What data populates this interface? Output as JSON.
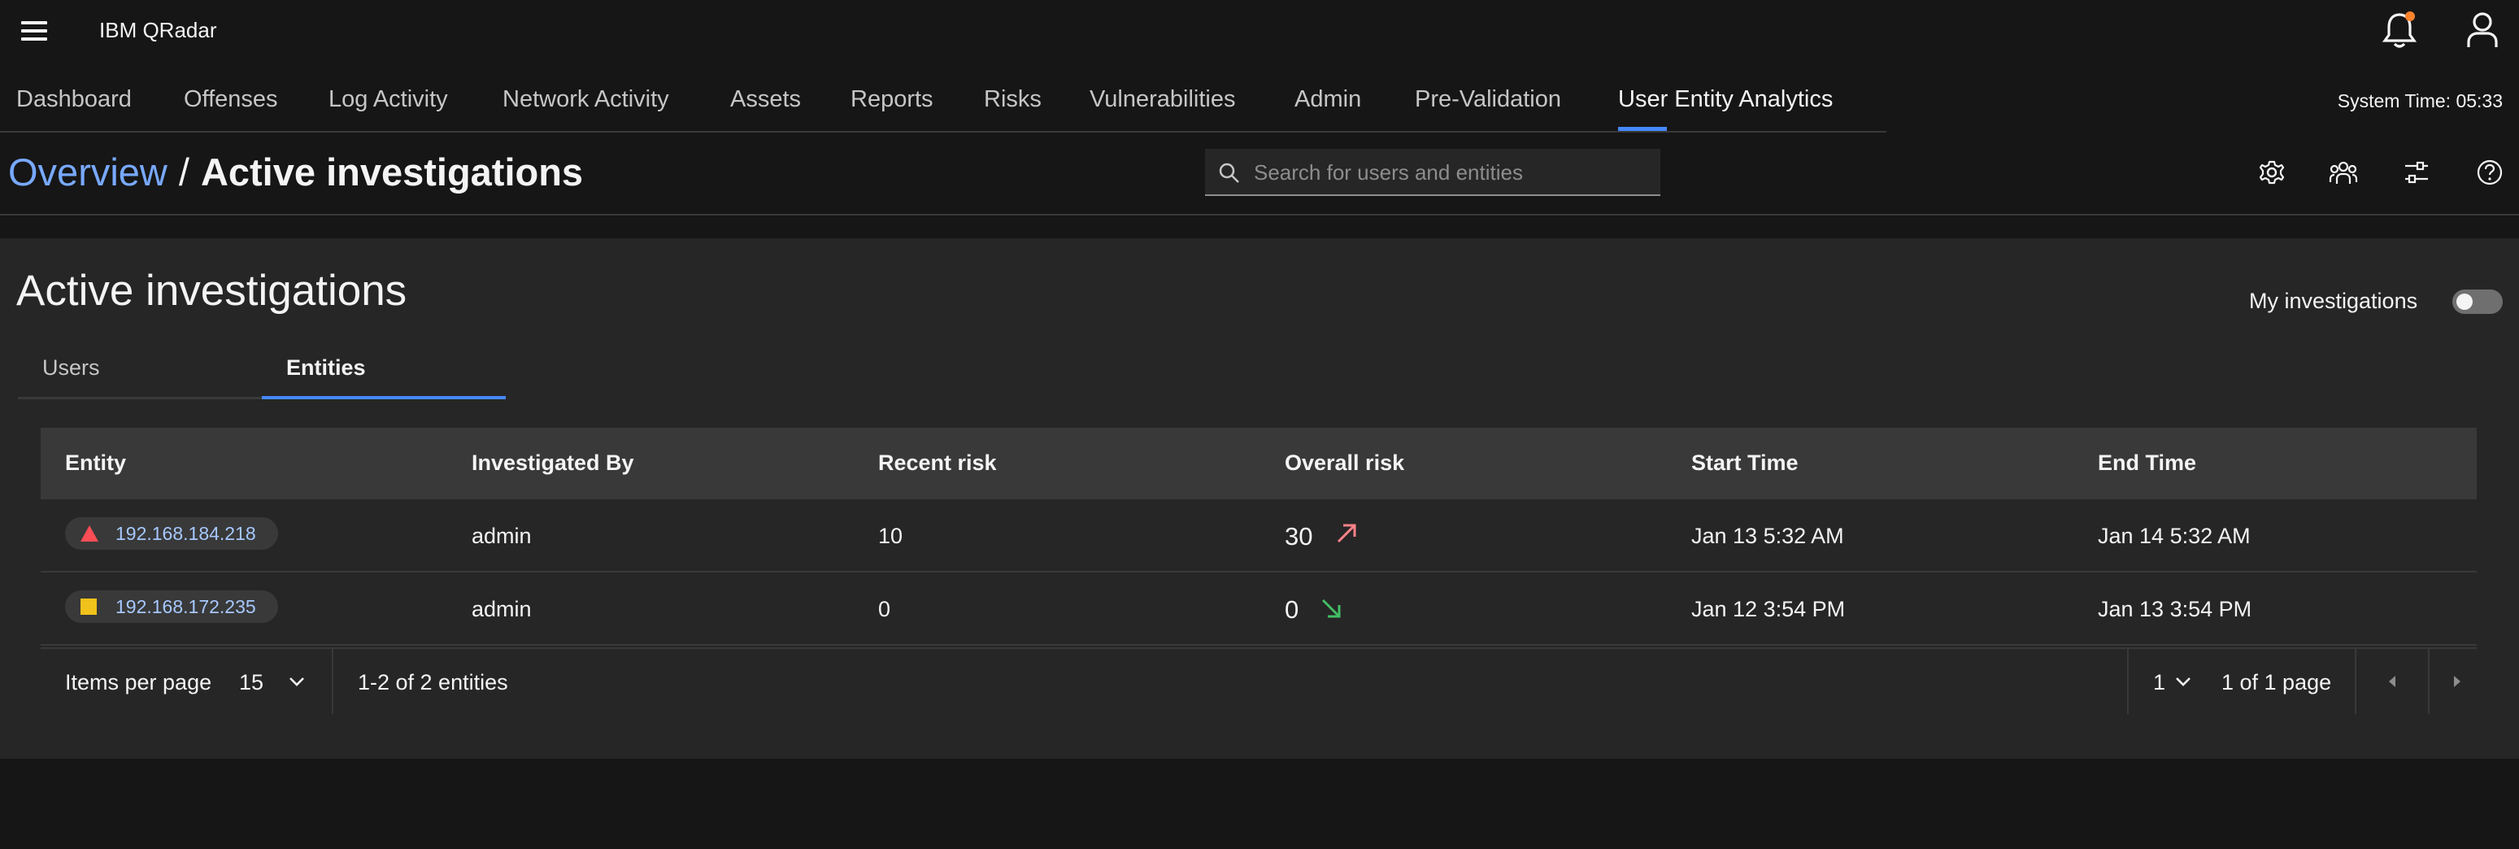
{
  "app": {
    "title": "IBM QRadar"
  },
  "nav": {
    "items": [
      {
        "label": "Dashboard"
      },
      {
        "label": "Offenses"
      },
      {
        "label": "Log Activity"
      },
      {
        "label": "Network Activity"
      },
      {
        "label": "Assets"
      },
      {
        "label": "Reports"
      },
      {
        "label": "Risks"
      },
      {
        "label": "Vulnerabilities"
      },
      {
        "label": "Admin"
      },
      {
        "label": "Pre-Validation"
      },
      {
        "label": "User Entity Analytics"
      }
    ],
    "active": "User Entity Analytics",
    "system_time": "System Time: 05:33"
  },
  "breadcrumb": {
    "parent": "Overview",
    "separator": "/",
    "current": "Active investigations"
  },
  "search": {
    "placeholder": "Search for users and entities",
    "value": ""
  },
  "panel": {
    "title": "Active investigations",
    "toggle_label": "My investigations",
    "toggle_on": false,
    "tabs": [
      {
        "label": "Users"
      },
      {
        "label": "Entities"
      }
    ],
    "active_tab": "Entities"
  },
  "table": {
    "headers": {
      "entity": "Entity",
      "investigated_by": "Investigated By",
      "recent_risk": "Recent risk",
      "overall_risk": "Overall risk",
      "start_time": "Start Time",
      "end_time": "End Time"
    },
    "rows": [
      {
        "entity": "192.168.184.218",
        "entity_icon": "red-triangle-icon",
        "investigated_by": "admin",
        "recent_risk": "10",
        "overall_risk": "30",
        "trend": "up",
        "start_time": "Jan 13 5:32 AM",
        "end_time": "Jan 14 5:32 AM"
      },
      {
        "entity": "192.168.172.235",
        "entity_icon": "yellow-square-icon",
        "investigated_by": "admin",
        "recent_risk": "0",
        "overall_risk": "0",
        "trend": "down",
        "start_time": "Jan 12 3:54 PM",
        "end_time": "Jan 13 3:54 PM"
      }
    ]
  },
  "pagination": {
    "items_per_page_label": "Items per page",
    "items_per_page": "15",
    "range": "1-2 of 2 entities",
    "current_page": "1",
    "page_count": "1 of 1 page"
  },
  "colors": {
    "accent": "#4589ff",
    "link": "#78a9ff",
    "risk_up": "#ff8389",
    "risk_down": "#42be65",
    "entity_red": "#fa4d56",
    "entity_yellow": "#f1c21b"
  }
}
